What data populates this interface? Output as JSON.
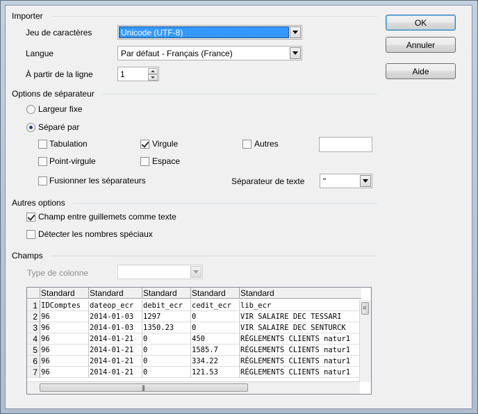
{
  "dialog": {
    "buttons": {
      "ok": "OK",
      "cancel": "Annuler",
      "help": "Aide"
    }
  },
  "importer": {
    "section": "Importer",
    "charset_label": "Jeu de caractères",
    "charset_value": "Unicode (UTF-8)",
    "language_label": "Langue",
    "language_value": "Par défaut - Français (France)",
    "from_line_label": "À partir de la ligne",
    "from_line_value": "1"
  },
  "separator": {
    "section": "Options de séparateur",
    "fixed_width": "Largeur fixe",
    "separated_by": "Séparé par",
    "tab": "Tabulation",
    "comma": "Virgule",
    "other": "Autres",
    "semicolon": "Point-virgule",
    "space": "Espace",
    "merge": "Fusionner les séparateurs",
    "text_sep_label": "Séparateur de texte",
    "text_sep_value": "\""
  },
  "other_options": {
    "section": "Autres options",
    "quoted_as_text": "Champ entre guillemets comme texte",
    "detect_special": "Détecter les nombres spéciaux"
  },
  "fields": {
    "section": "Champs",
    "column_type_label": "Type de colonne",
    "column_type_value": "",
    "headers": [
      "Standard",
      "Standard",
      "Standard",
      "Standard",
      "Standard"
    ],
    "rows": [
      [
        "1",
        "IDComptes",
        "dateop_ecr",
        "debit_ecr",
        "cedit_ecr",
        "lib_ecr"
      ],
      [
        "2",
        "96",
        "2014-01-03",
        "1297",
        "0",
        "VIR SALAIRE DEC TESSARI"
      ],
      [
        "3",
        "96",
        "2014-01-03",
        "1350.23",
        "0",
        "VIR SALAIRE DEC SENTURCK"
      ],
      [
        "4",
        "96",
        "2014-01-21",
        "0",
        "450",
        "RÉGLEMENTS CLIENTS natur1"
      ],
      [
        "5",
        "96",
        "2014-01-21",
        "0",
        "1585.7",
        "RÉGLEMENTS CLIENTS natur1"
      ],
      [
        "6",
        "96",
        "2014-01-21",
        "0",
        "334.22",
        "RÉGLEMENTS CLIENTS natur1"
      ],
      [
        "7",
        "96",
        "2014-01-21",
        "0",
        "121.53",
        "RÉGLEMENTS CLIENTS natur1"
      ]
    ]
  }
}
